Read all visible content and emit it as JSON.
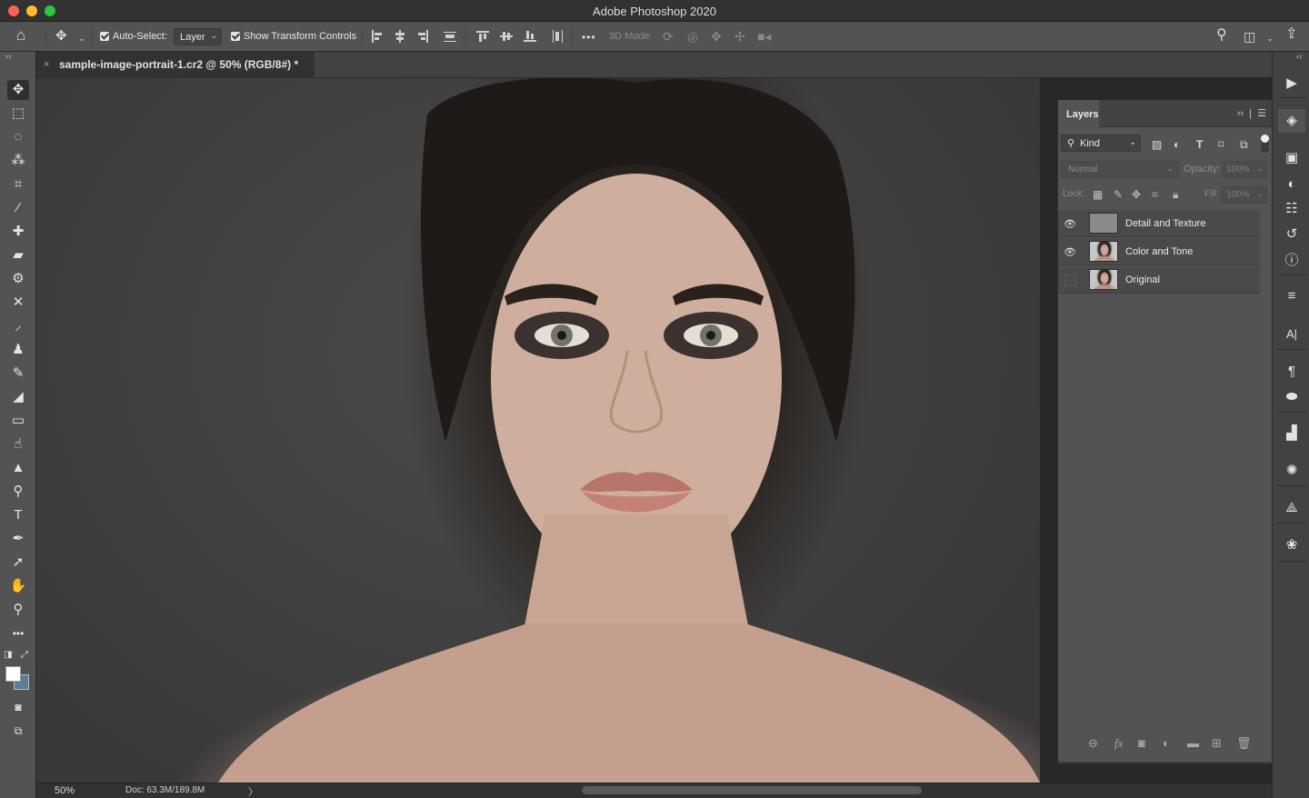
{
  "window": {
    "title": "Adobe Photoshop 2020"
  },
  "options_bar": {
    "home_icon": "home-icon",
    "move_icon": "move-tool-icon",
    "auto_select_label": "Auto-Select:",
    "auto_select_value": "Layer",
    "show_transform_label": "Show Transform Controls",
    "more_label": "•••",
    "mode_3d_label": "3D Mode:",
    "search_icon": "search-icon",
    "workspace_icon": "workspace-icon",
    "share_icon": "share-icon"
  },
  "document": {
    "tab_title": "sample-image-portrait-1.cr2 @ 50% (RGB/8#) *",
    "close_glyph": "×"
  },
  "status_bar": {
    "zoom": "50%",
    "doc_info": "Doc: 63.3M/189.8M",
    "arrow": "〉"
  },
  "tools": [
    {
      "name": "move-tool",
      "glyph": "✥",
      "active": true
    },
    {
      "name": "marquee-tool",
      "glyph": "⬚"
    },
    {
      "name": "lasso-tool",
      "glyph": "◌"
    },
    {
      "name": "magic-wand-tool",
      "glyph": "⁂"
    },
    {
      "name": "crop-tool",
      "glyph": "⌗"
    },
    {
      "name": "eyedropper-tool",
      "glyph": "⁄"
    },
    {
      "name": "spot-healing-tool",
      "glyph": "✚"
    },
    {
      "name": "healing-brush-tool",
      "glyph": "▰"
    },
    {
      "name": "patch-tool",
      "glyph": "⚙"
    },
    {
      "name": "content-aware-move-tool",
      "glyph": "✕"
    },
    {
      "name": "brush-tool",
      "glyph": "⸝"
    },
    {
      "name": "clone-stamp-tool",
      "glyph": "♟"
    },
    {
      "name": "history-brush-tool",
      "glyph": "✎"
    },
    {
      "name": "eraser-tool",
      "glyph": "◢"
    },
    {
      "name": "gradient-tool",
      "glyph": "▭"
    },
    {
      "name": "smudge-tool",
      "glyph": "☝"
    },
    {
      "name": "sharpen-tool",
      "glyph": "▲"
    },
    {
      "name": "dodge-tool",
      "glyph": "⚲"
    },
    {
      "name": "type-tool",
      "glyph": "T"
    },
    {
      "name": "pen-tool",
      "glyph": "✒"
    },
    {
      "name": "path-selection-tool",
      "glyph": "➚"
    },
    {
      "name": "hand-tool",
      "glyph": "✋"
    },
    {
      "name": "zoom-tool",
      "glyph": "⚲"
    },
    {
      "name": "more-tools",
      "glyph": "•••"
    }
  ],
  "layers_panel": {
    "title": "Layers",
    "filter_kind": "Kind",
    "blend_mode": "Normal",
    "opacity_label": "Opacity:",
    "opacity_value": "100%",
    "lock_label": "Lock:",
    "fill_label": "Fill:",
    "fill_value": "100%",
    "layers": [
      {
        "name": "Detail and Texture",
        "visible": true,
        "thumb": "gray"
      },
      {
        "name": "Color and Tone",
        "visible": true,
        "thumb": "portrait"
      },
      {
        "name": "Original",
        "visible": false,
        "thumb": "portrait"
      }
    ],
    "footer_icons": [
      "link-icon",
      "fx-icon",
      "mask-icon",
      "adjustment-icon",
      "folder-icon",
      "new-layer-icon",
      "trash-icon"
    ]
  },
  "right_dock": [
    {
      "name": "play-icon",
      "glyph": "▶"
    },
    {
      "name": "layers-panel-icon",
      "glyph": "◈",
      "active": true
    },
    {
      "name": "libraries-icon",
      "glyph": "▣"
    },
    {
      "name": "adjustments-icon",
      "glyph": "◐"
    },
    {
      "name": "properties-icon",
      "glyph": "☷"
    },
    {
      "name": "history-icon",
      "glyph": "↺"
    },
    {
      "name": "info-icon",
      "glyph": "ⓘ"
    },
    {
      "name": "channels-icon",
      "glyph": "≡"
    },
    {
      "name": "character-icon",
      "glyph": "A|"
    },
    {
      "name": "paragraph-icon",
      "glyph": "¶"
    },
    {
      "name": "psd-icon",
      "glyph": "⬬"
    },
    {
      "name": "histogram-icon",
      "glyph": "▟"
    },
    {
      "name": "brushes-icon",
      "glyph": "✺"
    },
    {
      "name": "paths-icon",
      "glyph": "⟁"
    },
    {
      "name": "color-icon",
      "glyph": "❀"
    }
  ]
}
